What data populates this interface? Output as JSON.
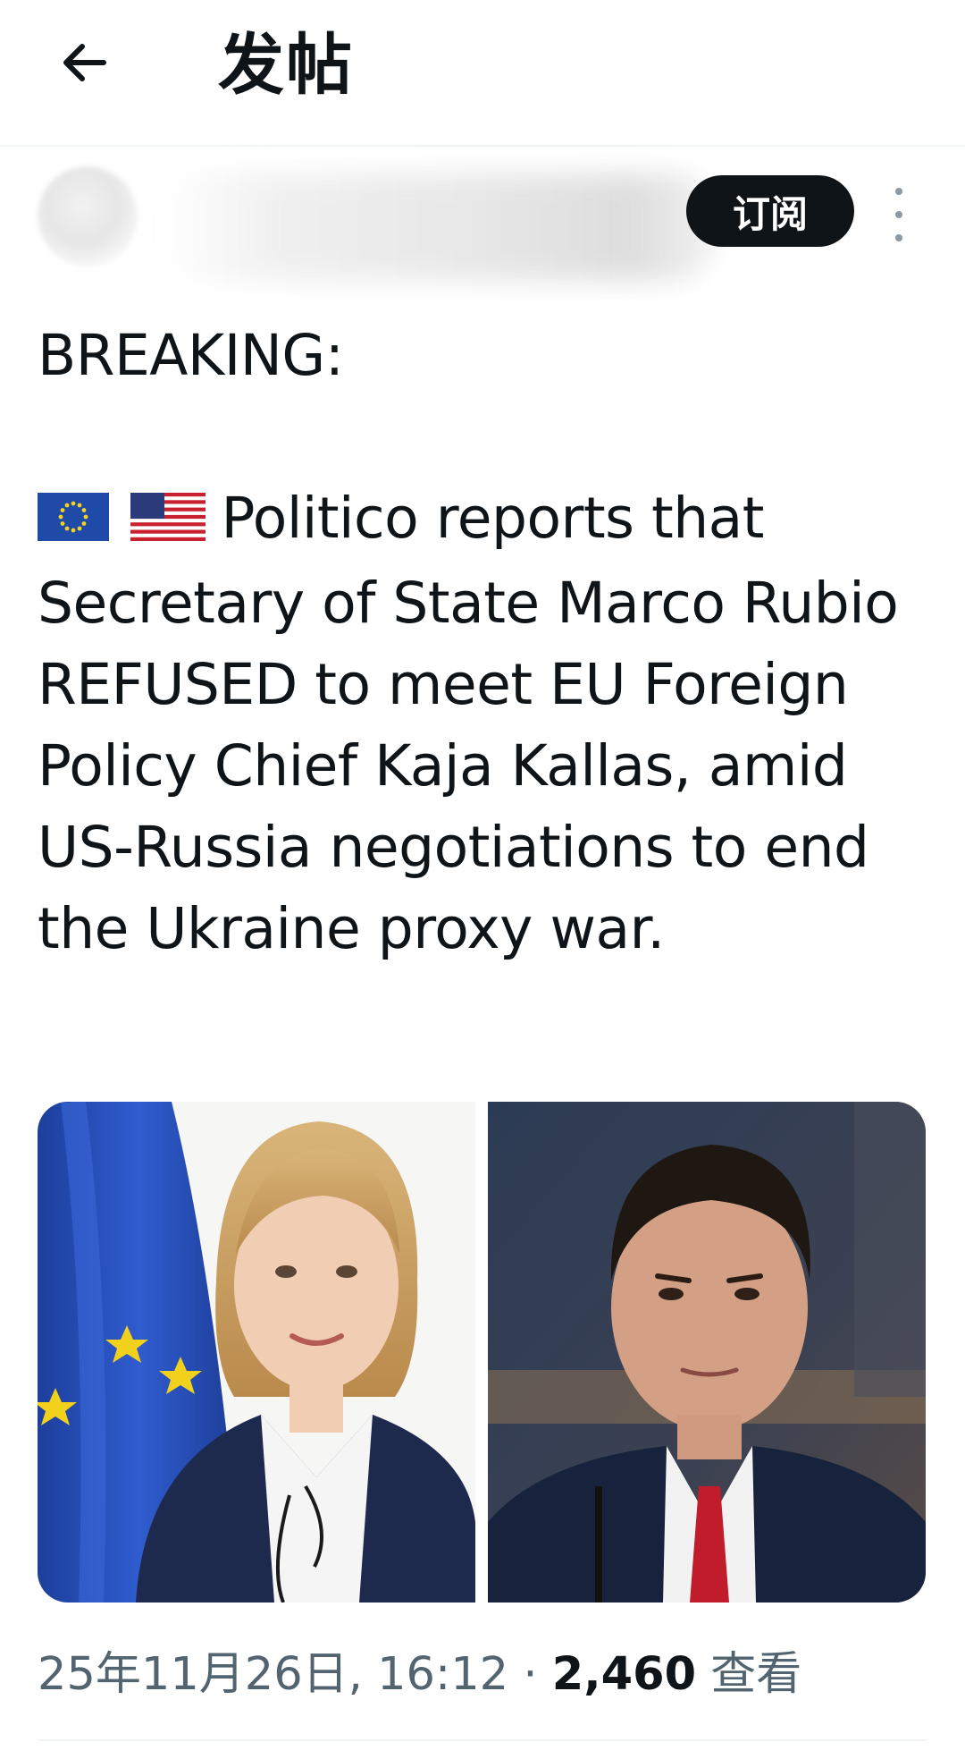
{
  "header": {
    "back_icon": "arrow-left-icon",
    "title": "发帖"
  },
  "author": {
    "subscribe_label": "订阅",
    "more_icon": "more-vertical-icon"
  },
  "post": {
    "line_breaking": "BREAKING:",
    "flag_icons": [
      "eu-flag-icon",
      "us-flag-icon"
    ],
    "body": "Politico reports that Secretary of State Marco Rubio REFUSED to meet EU Foreign Policy Chief Kaja Kallas, amid US-Russia negotiations to end the Ukraine proxy war."
  },
  "media": {
    "photos": [
      "photo-kaja-kallas",
      "photo-marco-rubio"
    ]
  },
  "meta": {
    "timestamp": "25年11月26日, 16:12",
    "separator": "·",
    "views_count": "2,460",
    "views_label": "查看"
  },
  "colors": {
    "text": "#0f1419",
    "secondary": "#536471",
    "divider": "#eff3f4",
    "button_bg": "#0f1419"
  }
}
